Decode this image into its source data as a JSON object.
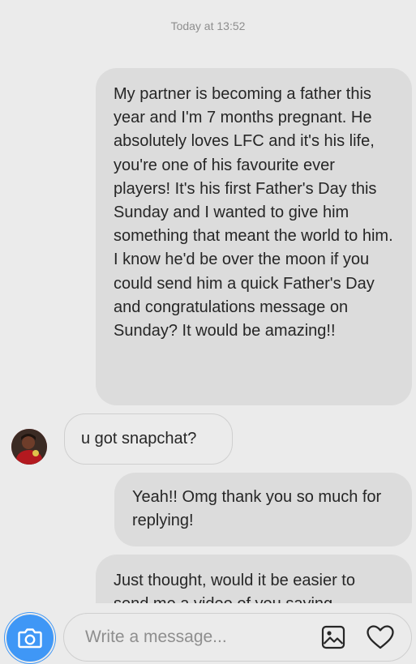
{
  "thread": {
    "timestamp": "Today at 13:52",
    "messages": [
      {
        "direction": "sent",
        "text": "My partner is becoming a father this year and I'm 7 months pregnant. He absolutely loves LFC and it's his life, you're one of his favourite ever players! It's his first Father's Day this Sunday and I wanted to give him something that meant the world to him. I know he'd be over the moon if you could send him a quick Father's Day and congratulations message on Sunday? It would be amazing!!"
      },
      {
        "direction": "received",
        "text": "u got snapchat?"
      },
      {
        "direction": "sent",
        "text": "Yeah!! Omg thank you so much for replying!"
      },
      {
        "direction": "sent",
        "text": "Just thought, would it be easier to send me a video of you saying"
      }
    ]
  },
  "composer": {
    "placeholder": "Write a message...",
    "value": ""
  },
  "icons": {
    "camera": "camera-icon",
    "gallery": "gallery-icon",
    "heart": "heart-icon"
  },
  "colors": {
    "background": "#ebebeb",
    "sent_bubble": "#dcdcdc",
    "camera_button": "#3f97f6",
    "timestamp_text": "#8e8e8e"
  }
}
